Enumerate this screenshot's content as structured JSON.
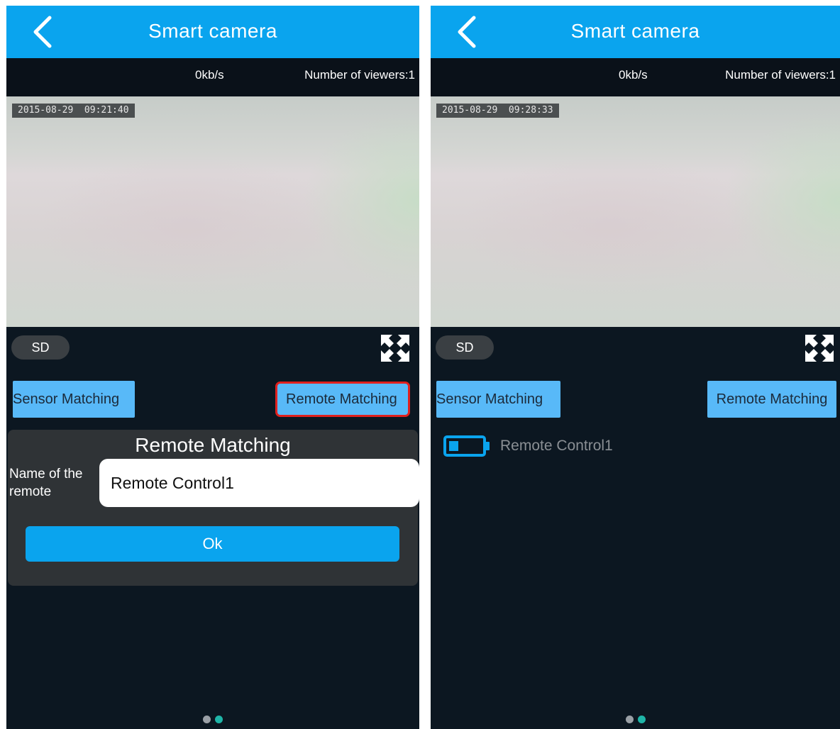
{
  "colors": {
    "app_bar": "#0aa4ee",
    "background": "#0c1721",
    "match_button": "#58b9f8",
    "highlight_box": "#e0201e",
    "page_dot_active": "#1fb5a8"
  },
  "screens": [
    {
      "app_bar": {
        "back_icon": "chevron-left-icon",
        "title": "Smart camera"
      },
      "status": {
        "bitrate": "0kb/s",
        "viewers": "Number of viewers:1"
      },
      "video": {
        "timestamp": "2015-08-29  09:21:40"
      },
      "quality_button": "SD",
      "fullscreen_icon": "expand-arrows-icon",
      "sensor_matching_label": "Sensor Matching",
      "remote_matching_label": "Remote Matching",
      "remote_matching_highlighted": true,
      "dialog": {
        "title": "Remote Matching",
        "name_label": "Name of the remote",
        "name_value": "Remote Control1",
        "ok_label": "Ok"
      },
      "pager": {
        "count": 2,
        "active": 1
      }
    },
    {
      "app_bar": {
        "back_icon": "chevron-left-icon",
        "title": "Smart camera"
      },
      "status": {
        "bitrate": "0kb/s",
        "viewers": "Number of viewers:1"
      },
      "video": {
        "timestamp": "2015-08-29  09:28:33"
      },
      "quality_button": "SD",
      "fullscreen_icon": "expand-arrows-icon",
      "sensor_matching_label": "Sensor Matching",
      "remote_matching_label": "Remote Matching",
      "remotes": [
        {
          "icon": "battery-icon",
          "battery_level": 0.3,
          "name": "Remote Control1"
        }
      ],
      "pager": {
        "count": 2,
        "active": 1
      }
    }
  ]
}
